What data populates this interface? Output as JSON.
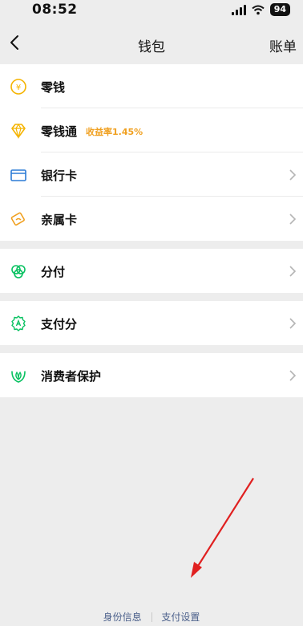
{
  "status": {
    "time": "08:52",
    "battery": "94"
  },
  "nav": {
    "title": "钱包",
    "right": "账单"
  },
  "groups": {
    "wallet": [
      {
        "label": "零钱",
        "icon": "yen-coin-icon"
      },
      {
        "label": "零钱通",
        "tag": "收益率1.45%",
        "icon": "diamond-icon"
      },
      {
        "label": "银行卡",
        "icon": "bank-card-icon"
      },
      {
        "label": "亲属卡",
        "icon": "family-card-icon"
      }
    ],
    "fenfu": [
      {
        "label": "分付",
        "icon": "fenfu-icon"
      }
    ],
    "payscore": [
      {
        "label": "支付分",
        "icon": "pay-score-icon"
      }
    ],
    "protect": [
      {
        "label": "消费者保护",
        "icon": "consumer-protection-icon"
      }
    ]
  },
  "footer": {
    "identity": "身份信息",
    "settings": "支付设置"
  },
  "colors": {
    "accent_green": "#07c160",
    "yellow": "#f5b400",
    "blue": "#2b7bd6",
    "orange": "#f0a020",
    "arrow": "#e02020"
  }
}
